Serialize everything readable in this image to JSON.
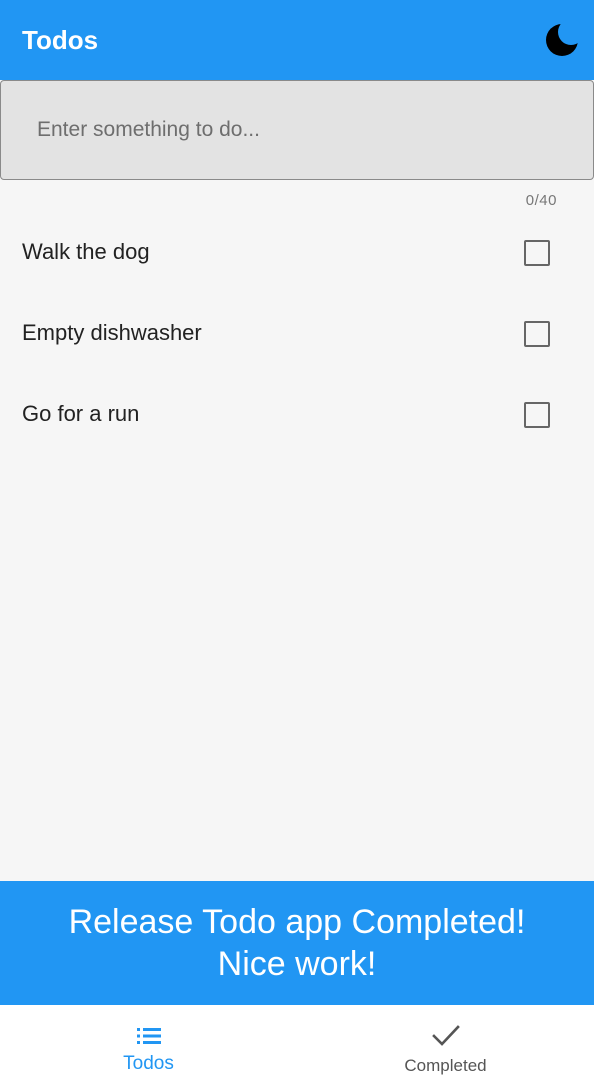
{
  "appbar": {
    "title": "Todos",
    "theme_icon": "moon-icon",
    "color": "#2196f3"
  },
  "input": {
    "value": "",
    "placeholder": "Enter something to do...",
    "counter": "0/40"
  },
  "todos": [
    {
      "label": "Walk the dog",
      "checked": false
    },
    {
      "label": "Empty dishwasher",
      "checked": false
    },
    {
      "label": "Go for a run",
      "checked": false
    }
  ],
  "snackbar": {
    "line1": "Release Todo app Completed!",
    "line2": "Nice work!"
  },
  "bottom_nav": {
    "items": [
      {
        "label": "Todos",
        "icon": "list-icon",
        "active": true
      },
      {
        "label": "Completed",
        "icon": "check-icon",
        "active": false
      }
    ],
    "active_color": "#2196f3"
  }
}
